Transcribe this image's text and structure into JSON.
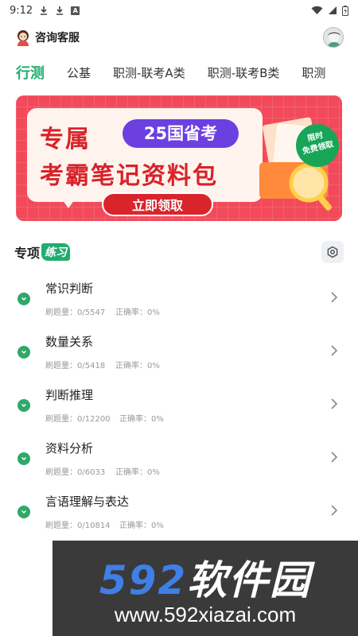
{
  "status_bar": {
    "time": "9:12"
  },
  "header": {
    "service_label": "咨询客服"
  },
  "tabs": [
    {
      "label": "行测",
      "active": true
    },
    {
      "label": "公基",
      "active": false
    },
    {
      "label": "职测-联考A类",
      "active": false
    },
    {
      "label": "职测-联考B类",
      "active": false
    },
    {
      "label": "职测",
      "active": false
    }
  ],
  "banner": {
    "title_line1": "专属",
    "pill": "25国省考",
    "title_line2": "考霸笔记资料包",
    "cta": "立即领取",
    "badge_line1": "限时",
    "badge_line2": "免费领取"
  },
  "section": {
    "title": "专项",
    "tag": "练习"
  },
  "practice_items": [
    {
      "title": "常识判断",
      "count": "刷题量：0/5547",
      "accuracy": "正确率：0%"
    },
    {
      "title": "数量关系",
      "count": "刷题量：0/5418",
      "accuracy": "正确率：0%"
    },
    {
      "title": "判断推理",
      "count": "刷题量：0/12200",
      "accuracy": "正确率：0%"
    },
    {
      "title": "资料分析",
      "count": "刷题量：0/6033",
      "accuracy": "正确率：0%"
    },
    {
      "title": "言语理解与表达",
      "count": "刷题量：0/10814",
      "accuracy": "正确率：0%"
    }
  ],
  "watermark": {
    "numbers": "592",
    "name": "软件园",
    "url": "www.592xiazai.com"
  },
  "colors": {
    "accent": "#1fae6e",
    "banner": "#f24a5a",
    "pill": "#6c3fe0"
  }
}
